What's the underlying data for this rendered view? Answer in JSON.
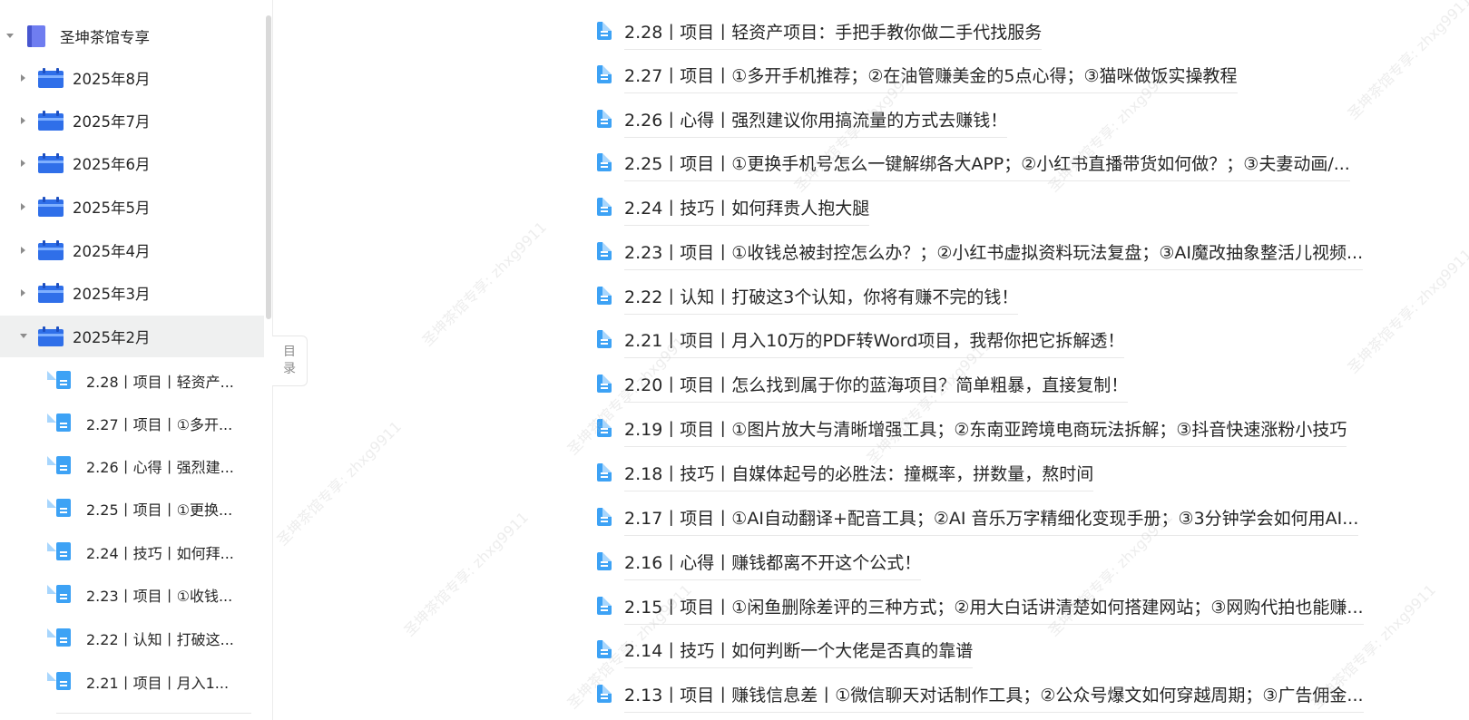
{
  "sidebar": {
    "root": {
      "label": "圣坤茶馆专享",
      "icon": "book-icon"
    },
    "months": [
      {
        "label": "2025年8月",
        "expanded": false,
        "icon": "calendar-folder-icon"
      },
      {
        "label": "2025年7月",
        "expanded": false,
        "icon": "calendar-folder-icon"
      },
      {
        "label": "2025年6月",
        "expanded": false,
        "icon": "calendar-folder-icon"
      },
      {
        "label": "2025年5月",
        "expanded": false,
        "icon": "calendar-folder-icon"
      },
      {
        "label": "2025年4月",
        "expanded": false,
        "icon": "calendar-folder-icon"
      },
      {
        "label": "2025年3月",
        "expanded": false,
        "icon": "calendar-folder-icon"
      },
      {
        "label": "2025年2月",
        "expanded": true,
        "selected": true,
        "icon": "calendar-folder-icon"
      }
    ],
    "children": [
      {
        "label": "2.28丨项目丨轻资产..."
      },
      {
        "label": "2.27丨项目丨①多开..."
      },
      {
        "label": "2.26丨心得丨强烈建..."
      },
      {
        "label": "2.25丨项目丨①更换..."
      },
      {
        "label": "2.24丨技巧丨如何拜..."
      },
      {
        "label": "2.23丨项目丨①收钱..."
      },
      {
        "label": "2.22丨认知丨打破这..."
      },
      {
        "label": "2.21丨项目丨月入1..."
      }
    ]
  },
  "toc_toggle": {
    "line1": "目",
    "line2": "录"
  },
  "articles": [
    {
      "title": "2.28丨项目丨轻资产项目：手把手教你做二手代找服务"
    },
    {
      "title": "2.27丨项目丨①多开手机推荐；②在油管赚美金的5点心得；③猫咪做饭实操教程"
    },
    {
      "title": "2.26丨心得丨强烈建议你用搞流量的方式去赚钱！"
    },
    {
      "title": "2.25丨项目丨①更换手机号怎么一键解绑各大APP；②小红书直播带货如何做？；③夫妻动画/..."
    },
    {
      "title": "2.24丨技巧丨如何拜贵人抱大腿"
    },
    {
      "title": "2.23丨项目丨①收钱总被封控怎么办？；②小红书虚拟资料玩法复盘；③AI魔改抽象整活儿视频..."
    },
    {
      "title": "2.22丨认知丨打破这3个认知，你将有赚不完的钱！"
    },
    {
      "title": "2.21丨项目丨月入10万的PDF转Word项目，我帮你把它拆解透！"
    },
    {
      "title": "2.20丨项目丨怎么找到属于你的蓝海项目？简单粗暴，直接复制！"
    },
    {
      "title": "2.19丨项目丨①图片放大与清晰增强工具；②东南亚跨境电商玩法拆解；③抖音快速涨粉小技巧"
    },
    {
      "title": "2.18丨技巧丨自媒体起号的必胜法：撞概率，拼数量，熬时间"
    },
    {
      "title": "2.17丨项目丨①AI自动翻译+配音工具；②AI 音乐万字精细化变现手册；③3分钟学会如何用AI..."
    },
    {
      "title": "2.16丨心得丨赚钱都离不开这个公式！"
    },
    {
      "title": "2.15丨项目丨①闲鱼删除差评的三种方式；②用大白话讲清楚如何搭建网站；③网购代拍也能赚..."
    },
    {
      "title": "2.14丨技巧丨如何判断一个大佬是否真的靠谱"
    },
    {
      "title": "2.13丨项目丨赚钱信息差丨①微信聊天对话制作工具；②公众号爆文如何穿越周期；③广告佣金..."
    }
  ],
  "watermark_text": "圣坤茶馆专享: zhxg9911"
}
